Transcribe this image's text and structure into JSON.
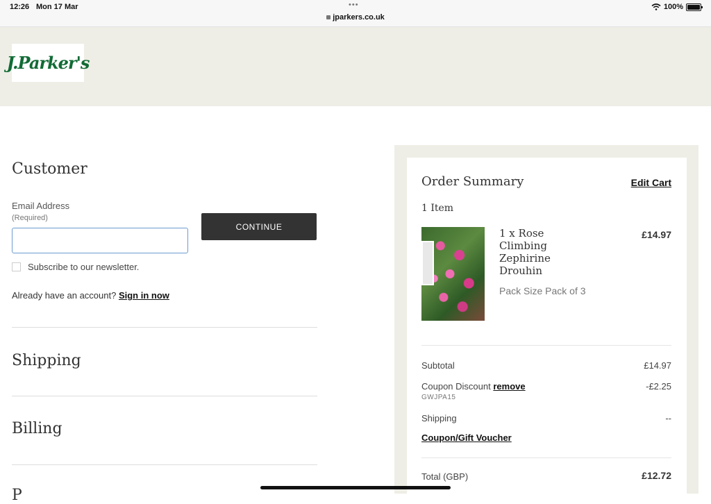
{
  "status_bar": {
    "time": "12:26",
    "date": "Mon 17 Mar",
    "url": "jparkers.co.uk",
    "battery": "100%"
  },
  "header": {
    "logo_text": "J.Parker's"
  },
  "customer": {
    "title": "Customer",
    "email_label": "Email Address",
    "required_label": "(Required)",
    "email_value": "",
    "continue_label": "CONTINUE",
    "newsletter_label": "Subscribe to our newsletter.",
    "account_prompt": "Already have an account?",
    "sign_in_label": "Sign in now"
  },
  "sections": {
    "shipping": "Shipping",
    "billing": "Billing",
    "payment_peek": "P"
  },
  "summary": {
    "title": "Order Summary",
    "edit_cart": "Edit Cart",
    "item_count": "1 Item",
    "item": {
      "name": "1 x Rose Climbing Zephirine Drouhin",
      "price": "£14.97",
      "pack": "Pack Size Pack of 3"
    },
    "subtotal_label": "Subtotal",
    "subtotal_value": "£14.97",
    "coupon_label": "Coupon Discount",
    "coupon_remove": "remove",
    "coupon_value": "-£2.25",
    "coupon_code": "GWJPA15",
    "shipping_label": "Shipping",
    "shipping_value": "--",
    "voucher_label": "Coupon/Gift Voucher",
    "total_label": "Total (GBP)",
    "total_value": "£12.72"
  },
  "colors": {
    "brand_green": "#116b35",
    "header_bg": "#eeeee6",
    "button_dark": "#333333",
    "input_focus": "#6b9bd0"
  }
}
